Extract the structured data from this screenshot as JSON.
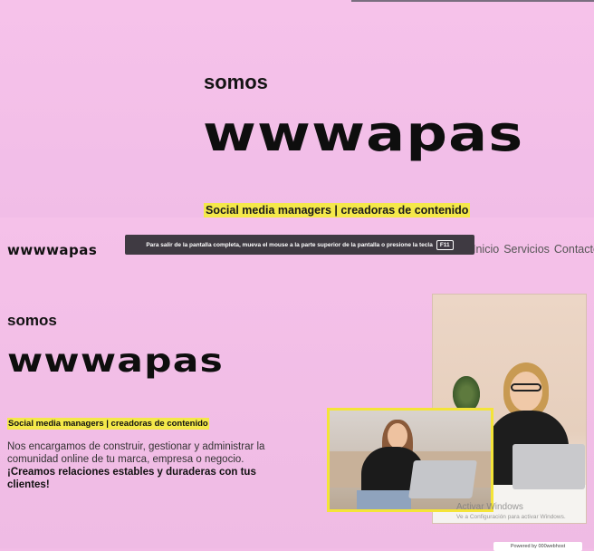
{
  "top_section": {
    "somos": "somos",
    "brand": "wwwapas",
    "tagline": "Social media managers | creadoras de contenido"
  },
  "site": {
    "logo": "wwwwapas",
    "nav": [
      "Inicio",
      "Servicios",
      "Contacto"
    ],
    "fullscreen_toast": {
      "message": "Para salir de la pantalla completa, mueva el mouse a la parte superior de la pantalla o presione la tecla",
      "key": "F11"
    },
    "hero": {
      "somos": "somos",
      "brand": "wwwapas",
      "tagline": "Social media managers | creadoras de contenido",
      "description": "Nos encargamos de construir, gestionar y administrar la comunidad online de tu marca, empresa o negocio.",
      "description_bold": "¡Creamos relaciones estables y duraderas con tus clientes!"
    },
    "watermark": {
      "title": "Activar Windows",
      "subtitle": "Ve a Configuración para activar Windows."
    },
    "powered_by": "Powered by 000webhost"
  },
  "colors": {
    "background": "#f2bde6",
    "highlight": "#f4e84a",
    "photo_frame": "#f4e438"
  }
}
